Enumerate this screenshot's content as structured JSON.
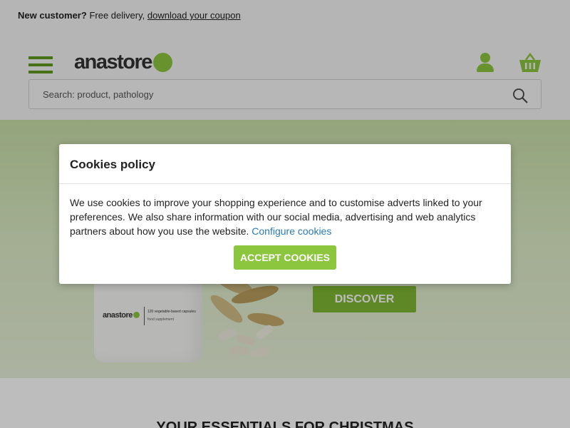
{
  "promo": {
    "bold": "New customer?",
    "text": "Free delivery,",
    "link": "download your coupon"
  },
  "header": {
    "logo_text": "anastore",
    "search_placeholder": "Search: product, pathology",
    "icons": [
      "menu-icon",
      "user-icon",
      "basket-icon",
      "search-icon"
    ]
  },
  "hero": {
    "product_brand": "anastore",
    "product_label_1": "120 vegetable-based capsules",
    "product_label_2": "food supplement",
    "button": "DISCOVER"
  },
  "section": {
    "title": "YOUR ESSENTIALS FOR CHRISTMAS"
  },
  "cookie_modal": {
    "title": "Cookies policy",
    "text": "We use cookies to improve your shopping experience and to customise adverts linked to your preferences. We also share information with our social media, advertising and web analytics partners about how you use the website.",
    "configure_link": "Configure cookies",
    "accept_button": "ACCEPT COOKIES"
  },
  "colors": {
    "brand_green": "#8cc63f",
    "menu_green": "#5f9a1f",
    "link_blue": "#2a7ab8"
  }
}
